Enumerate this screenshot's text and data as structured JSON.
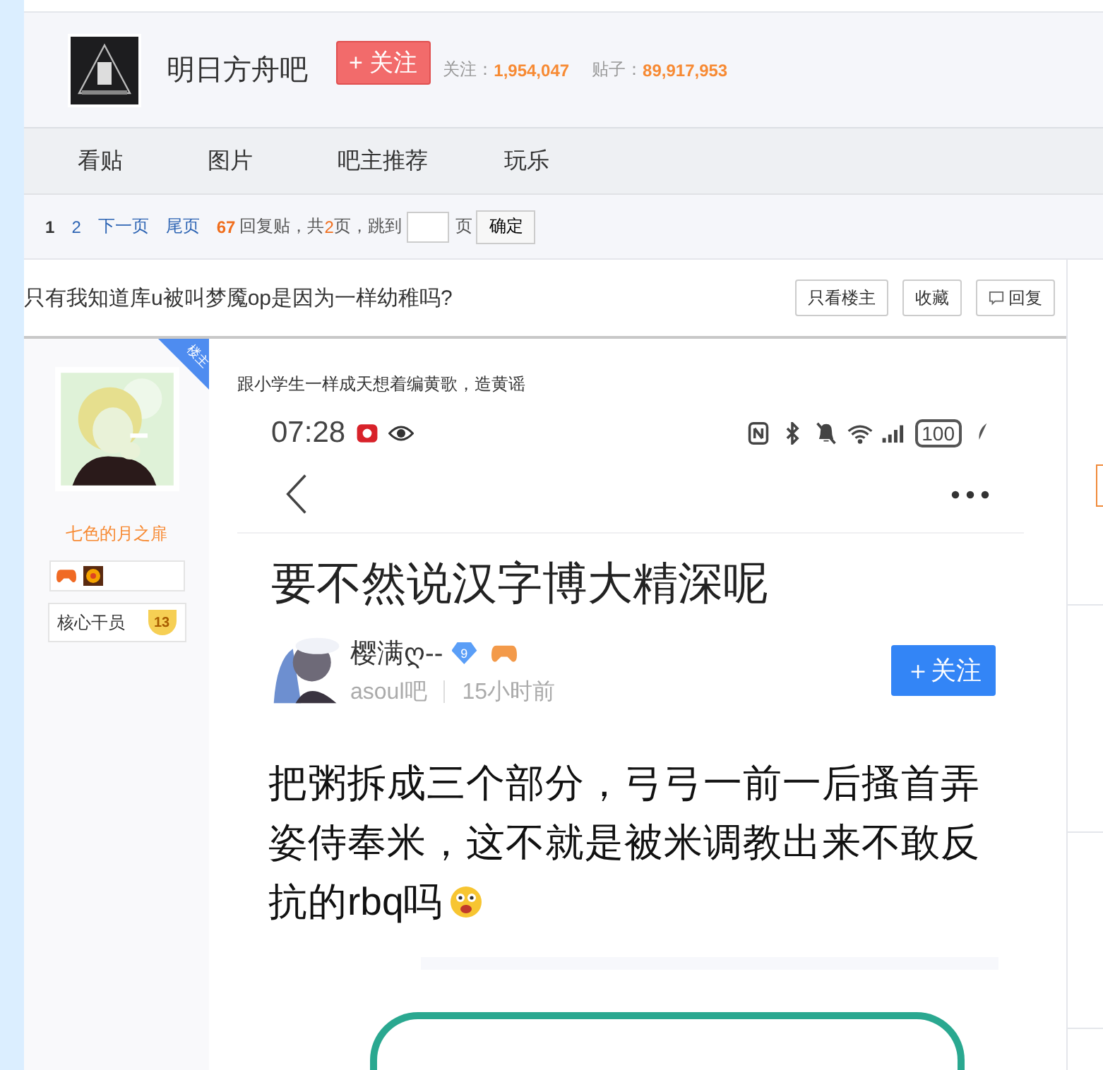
{
  "forum": {
    "name": "明日方舟吧",
    "follow_button": "+ 关注",
    "followers_label": "关注：",
    "followers": "1,954,047",
    "posts_label": "贴子：",
    "posts": "89,917,953"
  },
  "tabs": [
    {
      "label": "看贴"
    },
    {
      "label": "图片"
    },
    {
      "label": "吧主推荐"
    },
    {
      "label": "玩乐"
    }
  ],
  "pager": {
    "pages": [
      {
        "label": "1",
        "selected": true
      },
      {
        "label": "2",
        "selected": false
      }
    ],
    "next": "下一页",
    "last": "尾页",
    "reply_count": "67",
    "replies_text": "回复贴，共",
    "page_total": "2",
    "jump_text": "页，跳到",
    "page_unit": "页",
    "confirm": "确定"
  },
  "thread": {
    "title": "只有我知道库u被叫梦魇op是因为一样幼稚吗?",
    "buttons": [
      {
        "label": "只看楼主",
        "kind": "plain"
      },
      {
        "label": "收藏",
        "kind": "plain"
      },
      {
        "label": "回复",
        "kind": "reply"
      }
    ]
  },
  "post": {
    "author": {
      "name": "七色的月之扉",
      "badge": "楼主",
      "rank": "核心干员",
      "level": "13"
    },
    "text": "跟小学生一样成天想着编黄歌，造黄谣",
    "screenshot": {
      "time": "07:28",
      "battery": "100",
      "title": "要不然说汉字博大精深呢",
      "user": "樱满ღ--",
      "user_level": "9",
      "forum": "asoul吧",
      "time_ago": "15小时前",
      "follow": "＋关注",
      "body_lines": [
        "把粥拆成三个部分，弓弓一前一后搔首弄",
        "姿侍奉米，这不就是被米调教出来不敢反",
        "抗的rbq吗"
      ]
    }
  }
}
